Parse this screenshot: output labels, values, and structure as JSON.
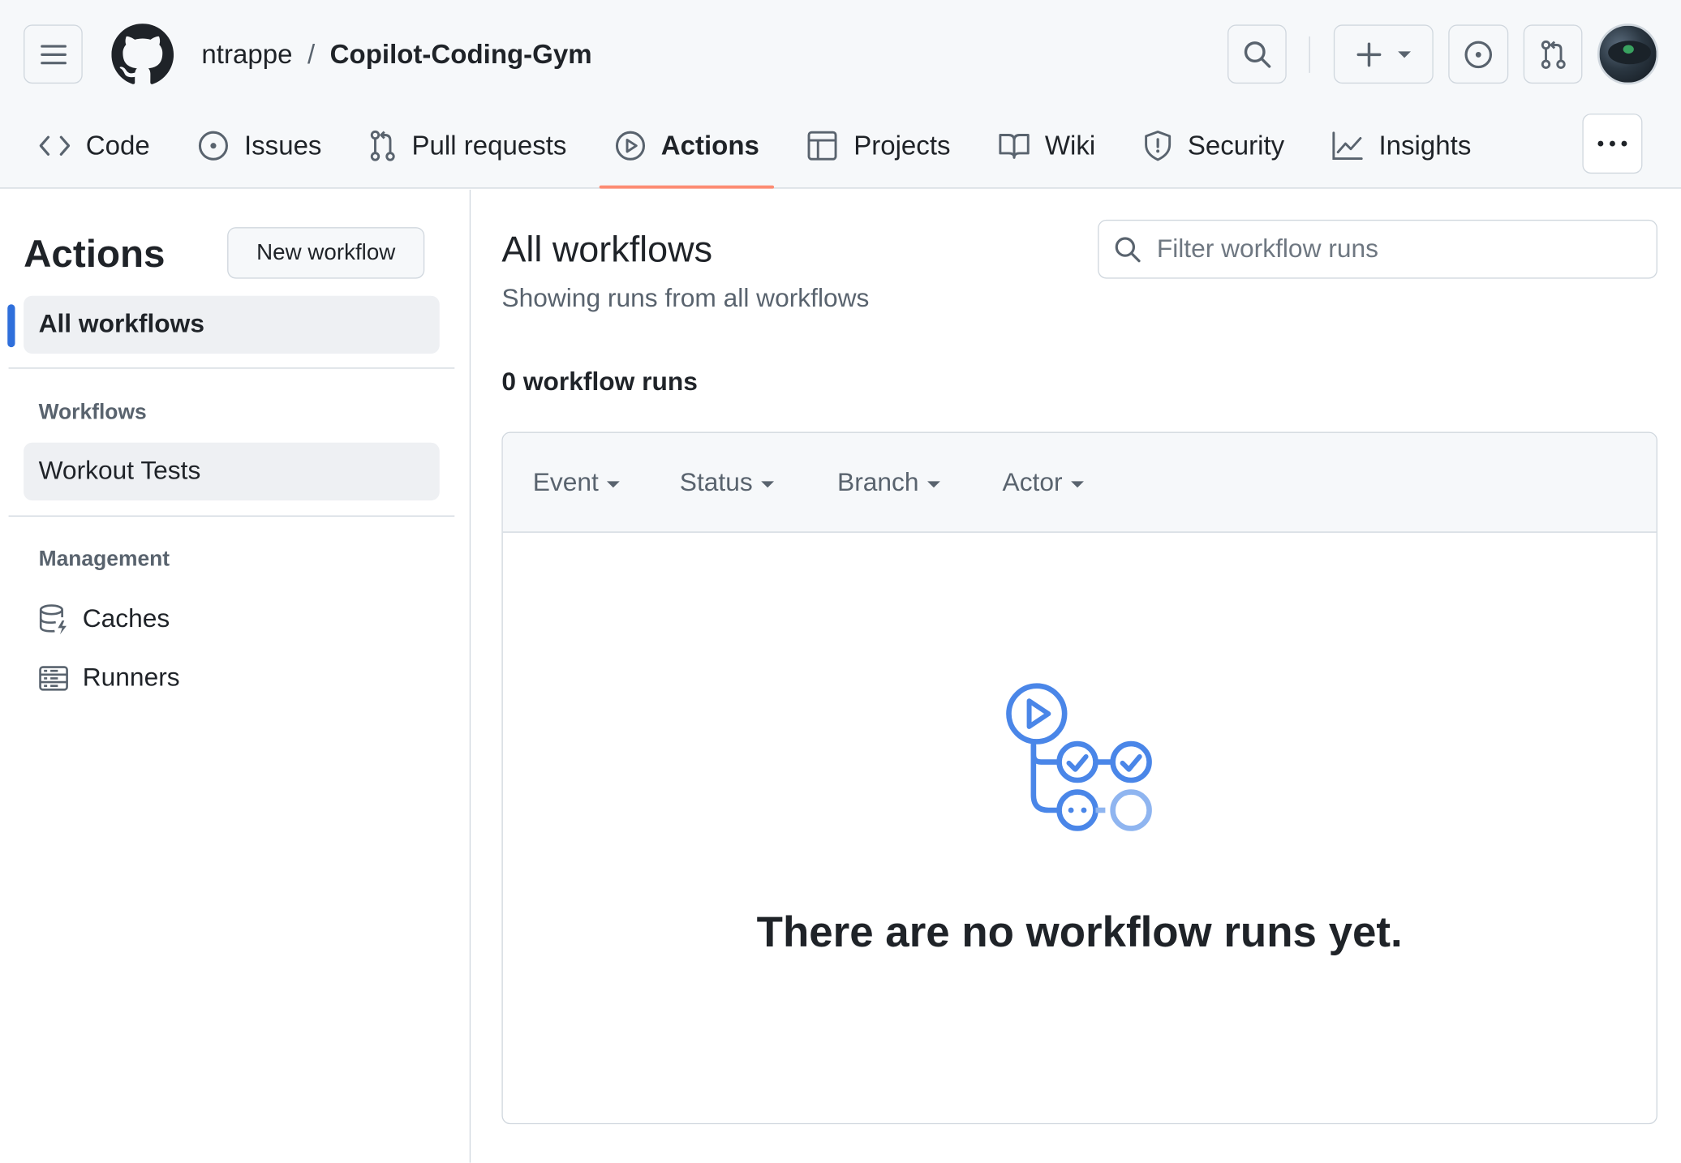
{
  "header": {
    "repo_owner": "ntrappe",
    "repo_separator": "/",
    "repo_name": "Copilot-Coding-Gym",
    "icons": {
      "menu": "hamburger-icon",
      "logo": "github-mark-icon",
      "search": "search-icon",
      "create": "plus-icon",
      "issues": "issue-opened-icon",
      "pulls": "git-pull-request-icon",
      "avatar": "user-avatar"
    }
  },
  "repo_nav": {
    "tabs": [
      {
        "label": "Code",
        "icon": "code-icon",
        "selected": false
      },
      {
        "label": "Issues",
        "icon": "issue-opened-icon",
        "selected": false
      },
      {
        "label": "Pull requests",
        "icon": "git-pull-request-icon",
        "selected": false
      },
      {
        "label": "Actions",
        "icon": "play-icon",
        "selected": true
      },
      {
        "label": "Projects",
        "icon": "table-icon",
        "selected": false
      },
      {
        "label": "Wiki",
        "icon": "book-icon",
        "selected": false
      },
      {
        "label": "Security",
        "icon": "shield-icon",
        "selected": false
      },
      {
        "label": "Insights",
        "icon": "graph-icon",
        "selected": false
      }
    ],
    "more_icon": "kebab-horizontal-icon"
  },
  "sidebar": {
    "title": "Actions",
    "new_workflow_label": "New workflow",
    "all_workflows_label": "All workflows",
    "workflows_heading": "Workflows",
    "workflows": [
      "Workout Tests"
    ],
    "management_heading": "Management",
    "management_items": [
      {
        "label": "Caches",
        "icon": "cache-icon"
      },
      {
        "label": "Runners",
        "icon": "server-icon"
      }
    ]
  },
  "main": {
    "title": "All workflows",
    "subtitle": "Showing runs from all workflows",
    "filter_placeholder": "Filter workflow runs",
    "run_count_label": "0 workflow runs",
    "filters": [
      "Event",
      "Status",
      "Branch",
      "Actor"
    ],
    "empty_title": "There are no workflow runs yet.",
    "empty_icon": "workflow-blankslate-icon"
  },
  "colors": {
    "accent_underline": "#fd8c73",
    "selected_indicator": "#2f6fdb",
    "blankslate_blue": "#4a86e8"
  }
}
